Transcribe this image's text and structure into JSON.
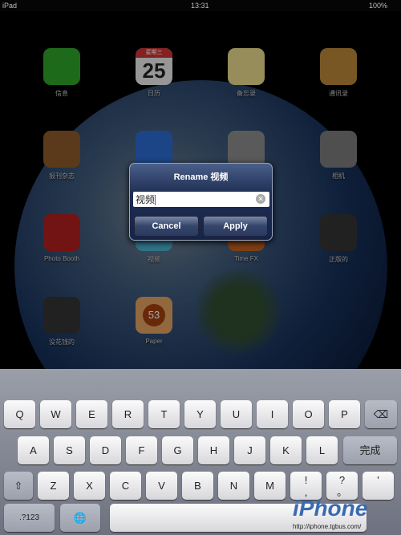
{
  "status": {
    "device": "iPad",
    "time": "13:31",
    "battery": "100%"
  },
  "apps": [
    {
      "label": "信息",
      "color": "#2fa32a"
    },
    {
      "label": "日历",
      "color": "#e8e8e8",
      "date": "25",
      "weekday": "星期三"
    },
    {
      "label": "备忘录",
      "color": "#e6d98a"
    },
    {
      "label": "通讯录",
      "color": "#b8863a"
    },
    {
      "label": "报刊杂志",
      "color": "#8a5a2a"
    },
    {
      "label": "",
      "color": "#2a6ad0"
    },
    {
      "label": "",
      "color": "#8a8a8a"
    },
    {
      "label": "相机",
      "color": "#7a7a7a"
    },
    {
      "label": "Photo Booth",
      "color": "#b02020"
    },
    {
      "label": "视频",
      "color": "#4ab0d0"
    },
    {
      "label": "Time FX",
      "color": "#c06020"
    },
    {
      "label": "正版的",
      "color": "#333"
    },
    {
      "label": "没花钱的",
      "color": "#333"
    },
    {
      "label": "Paper",
      "color": "#e0a060",
      "badge": "53"
    }
  ],
  "dialog": {
    "title": "Rename 视频",
    "value": "视频",
    "cancel": "Cancel",
    "apply": "Apply"
  },
  "keyboard": {
    "row1": [
      "Q",
      "W",
      "E",
      "R",
      "T",
      "Y",
      "U",
      "I",
      "O",
      "P"
    ],
    "row2": [
      "A",
      "S",
      "D",
      "F",
      "G",
      "H",
      "J",
      "K",
      "L"
    ],
    "done": "完成",
    "row3": [
      "Z",
      "X",
      "C",
      "V",
      "B",
      "N",
      "M"
    ],
    "punct": [
      "!\n,",
      "?\n。",
      "'"
    ],
    "numbers": ".?123"
  },
  "watermark": {
    "brand": "iPhone",
    "site": "http://iphone.tgbus.com/"
  }
}
